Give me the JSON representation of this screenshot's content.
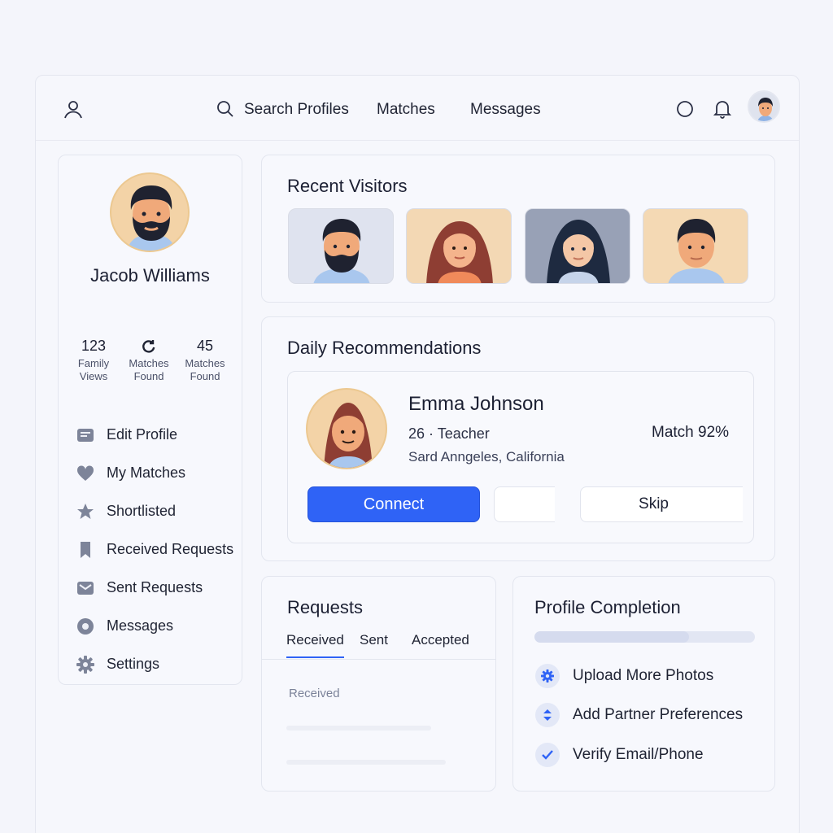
{
  "topbar": {
    "nav": {
      "search_label": "Search Profiles",
      "matches_label": "Matches",
      "messages_label": "Messages"
    },
    "icons": [
      "user-icon",
      "search-icon",
      "status-circle-icon",
      "bell-icon",
      "avatar"
    ]
  },
  "sidebar": {
    "name": "Jacob Williams",
    "stats": [
      {
        "value": "123",
        "label_line1": "Family",
        "label_line2": "Views"
      },
      {
        "value": "",
        "label_line1": "Matches",
        "label_line2": "Found",
        "icon": "refresh-icon"
      },
      {
        "value": "45",
        "label_line1": "Matches",
        "label_line2": "Found"
      }
    ],
    "menu": [
      {
        "label": "Edit Profile",
        "icon": "edit-profile-icon"
      },
      {
        "label": "My Matches",
        "icon": "heart-icon"
      },
      {
        "label": "Shortlisted",
        "icon": "star-icon"
      },
      {
        "label": "Received Requests",
        "icon": "bookmark-icon"
      },
      {
        "label": "Sent Requests",
        "icon": "envelope-icon"
      },
      {
        "label": "Messages",
        "icon": "message-disc-icon"
      },
      {
        "label": "Settings",
        "icon": "gear-icon"
      }
    ]
  },
  "visitors": {
    "title": "Recent Visitors"
  },
  "daily": {
    "title": "Daily Recommendations",
    "name": "Emma Johnson",
    "subtitle": "26 · Teacher",
    "location": "Sard Anngeles, California",
    "match": "Match 92%",
    "connect_label": "Connect",
    "skip_label": "Skip"
  },
  "requests": {
    "title": "Requests",
    "tabs": [
      "Received",
      "Sent",
      "Accepted"
    ],
    "active_tab": "Received",
    "empty_label": "Received"
  },
  "completion": {
    "title": "Profile Completion",
    "progress_fraction": 0.7,
    "tasks": [
      {
        "label": "Upload More Photos",
        "icon": "gear-icon"
      },
      {
        "label": "Add Partner Preferences",
        "icon": "sort-icon"
      },
      {
        "label": "Verify Email/Phone",
        "icon": "check-icon"
      }
    ]
  },
  "colors": {
    "accent": "#2f63f6",
    "background": "#f4f5fb",
    "text": "#1c2033"
  }
}
